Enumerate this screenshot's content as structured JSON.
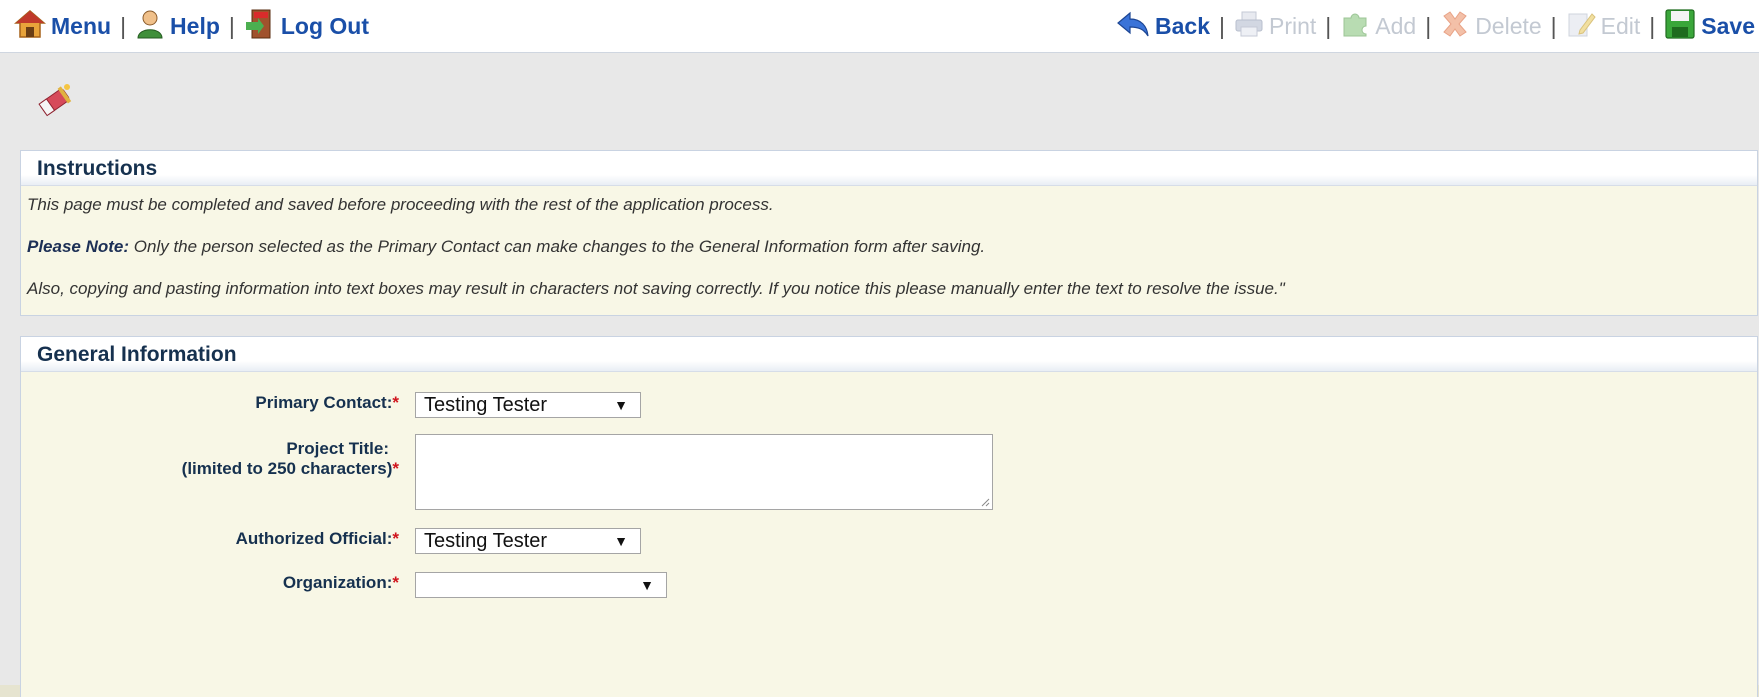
{
  "toolbar": {
    "left": [
      {
        "label": "Menu",
        "icon": "house-icon"
      },
      {
        "label": "Help",
        "icon": "person-help-icon"
      },
      {
        "label": "Log Out",
        "icon": "exit-door-icon"
      }
    ],
    "right": [
      {
        "label": "Back",
        "icon": "back-arrow-icon",
        "enabled": true
      },
      {
        "label": "Print",
        "icon": "printer-icon",
        "enabled": false
      },
      {
        "label": "Add",
        "icon": "add-puzzle-icon",
        "enabled": false
      },
      {
        "label": "Delete",
        "icon": "delete-x-icon",
        "enabled": false
      },
      {
        "label": "Edit",
        "icon": "edit-pencil-icon",
        "enabled": false
      },
      {
        "label": "Save",
        "icon": "floppy-save-icon",
        "enabled": true
      }
    ],
    "separator": "|"
  },
  "page_icon": "eraser-brush-icon",
  "instructions": {
    "title": "Instructions",
    "line1": "This page must be completed and saved before proceeding with the rest of the application process.",
    "line2_bold": "Please Note:",
    "line2_rest": " Only the person selected as the Primary Contact can make changes to the General Information form after saving.",
    "line3": "Also, copying and pasting information into text boxes may result in characters not saving correctly. If you notice this please manually enter the text to resolve the issue.\""
  },
  "general": {
    "title": "General Information",
    "required_mark": "*",
    "primary_contact": {
      "label": "Primary Contact:",
      "value": "Testing Tester"
    },
    "project_title": {
      "label_line1": "Project Title:",
      "label_line2": "(limited to 250 characters)",
      "value": ""
    },
    "authorized_official": {
      "label": "Authorized Official:",
      "value": "Testing Tester"
    },
    "organization": {
      "label": "Organization:",
      "value": ""
    },
    "caret": "▼"
  },
  "colors": {
    "link_blue": "#1a4fa8",
    "disabled_gray": "#c3c9d2",
    "required_red": "#d0141c",
    "section_bg": "#f8f7e6"
  }
}
